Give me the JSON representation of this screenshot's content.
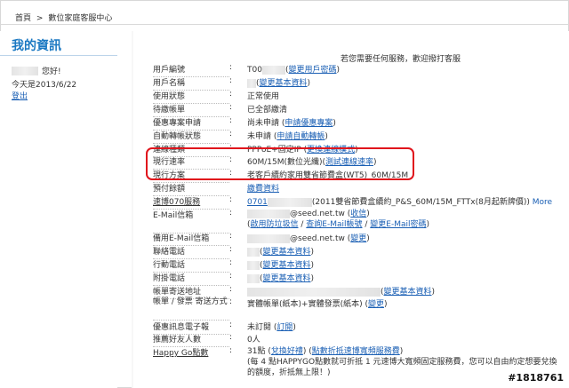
{
  "breadcrumb": [
    "首頁",
    ">",
    "數位家庭客服中心"
  ],
  "sidebar": {
    "title": "我的資訊",
    "greeting": "您好!",
    "today": "今天是2013/6/22",
    "logout": "登出"
  },
  "main": {
    "service_note": "若您需要任何服務，歡迎撥打客服",
    "rows": {
      "user_id": {
        "label": "用戶編號",
        "colon": ":",
        "value": "T00",
        "link": "變更用戶密碼"
      },
      "user_name": {
        "label": "用戶名稱",
        "colon": ":",
        "link": "變更基本資料"
      },
      "status": {
        "label": "使用狀態",
        "colon": ":",
        "value": "正常使用"
      },
      "pending": {
        "label": "待繳帳單",
        "colon": ":",
        "value": "已全部繳清"
      },
      "promo": {
        "label": "優惠專案申請",
        "colon": ":",
        "value": "尚未申請",
        "link": "申請優惠專案"
      },
      "auto_transfer": {
        "label": "自動轉帳狀態",
        "colon": ":",
        "value": "未申請",
        "link": "申請自動轉帳"
      },
      "connection": {
        "label": "連線種類",
        "colon": ":",
        "value": "PPPoE+固定IP",
        "link": "更換連線模式"
      },
      "speed": {
        "label": "現行速率",
        "colon": ":",
        "value": "60M/15M(數位光纖)",
        "link": "測試連線速率"
      },
      "plan": {
        "label": "現行方案",
        "colon": ":",
        "value": "老客戶續約家用雙省節費盒(WT5)_60M/15M"
      },
      "prepay": {
        "label": "預付餘額",
        "colon": "",
        "link": "繳費資料"
      },
      "voip070": {
        "label": "速博070服務",
        "colon": ":",
        "value": "0701",
        "value_rest": "(2011雙省節費盒續約_P&S_60M/15M_FTTx(8月起新牌價))",
        "more": "More"
      },
      "email": {
        "label": "E-Mail信箱",
        "colon": ":",
        "value": "@seed.net.tw",
        "link1": "收信",
        "link2": "啟用防垃圾信",
        "link3": "查詢E-Mail帳號",
        "link4": "變更E-Mail密碼"
      },
      "backup_email": {
        "label": "備用E-Mail信箱",
        "colon": ":",
        "value": "@seed.net.tw",
        "link": "變更"
      },
      "phone": {
        "label": "聯絡電話",
        "colon": ":",
        "link": "變更基本資料"
      },
      "mobile": {
        "label": "行動電話",
        "colon": ":",
        "link": "變更基本資料"
      },
      "ext": {
        "label": "附掛電話",
        "colon": ":",
        "link": "變更基本資料"
      },
      "billing_address": {
        "label": "帳單寄送地址",
        "colon": ":",
        "link": "變更基本資料"
      },
      "bill_method": {
        "label": "帳單 / 發票 寄送方式",
        "colon": ":",
        "value": "實體帳單(紙本)+實體發票(紙本)",
        "link": "變更"
      },
      "epaper": {
        "label": "優惠訊息電子報",
        "colon": ":",
        "value": "未訂閱",
        "link": "訂閱"
      },
      "referrals": {
        "label": "推薦好友人數",
        "colon": ":",
        "value": "0人"
      },
      "happygo": {
        "label": "Happy Go點數",
        "colon": ":",
        "value": "31點",
        "link1": "兌換好禮",
        "link2": "點數折抵速博寬頻服務費",
        "note": "(每 4 點HAPPYGO點數就可折抵 1 元速博大寬頻固定服務費，您可以自由約定想要兌換的額度，折抵無上限！)"
      }
    }
  },
  "watermark": "#1818761",
  "colors": {
    "accent": "#1a78c2",
    "link": "#1a5fb4",
    "highlight": "#e0141c"
  }
}
